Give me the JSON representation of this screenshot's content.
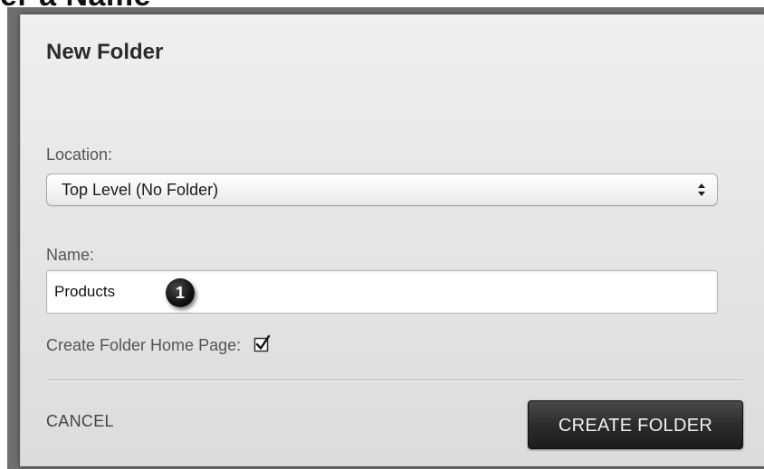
{
  "page_heading_fragment": "er a Name",
  "dialog": {
    "title": "New Folder",
    "location": {
      "label": "Location:",
      "selected": "Top Level (No Folder)"
    },
    "name": {
      "label": "Name:",
      "value": "Products"
    },
    "step_marker": "1",
    "home_page": {
      "label": "Create Folder Home Page:",
      "checked": true
    },
    "cancel_label": "CANCEL",
    "create_label": "CREATE FOLDER"
  },
  "colors": {
    "dialog_bg": "#e6e6e6",
    "primary_button": "#2c2c2c",
    "marker": "#111111"
  },
  "icons": {
    "select_arrows": "updown-arrows-icon",
    "checkbox": "checkmark-icon"
  }
}
